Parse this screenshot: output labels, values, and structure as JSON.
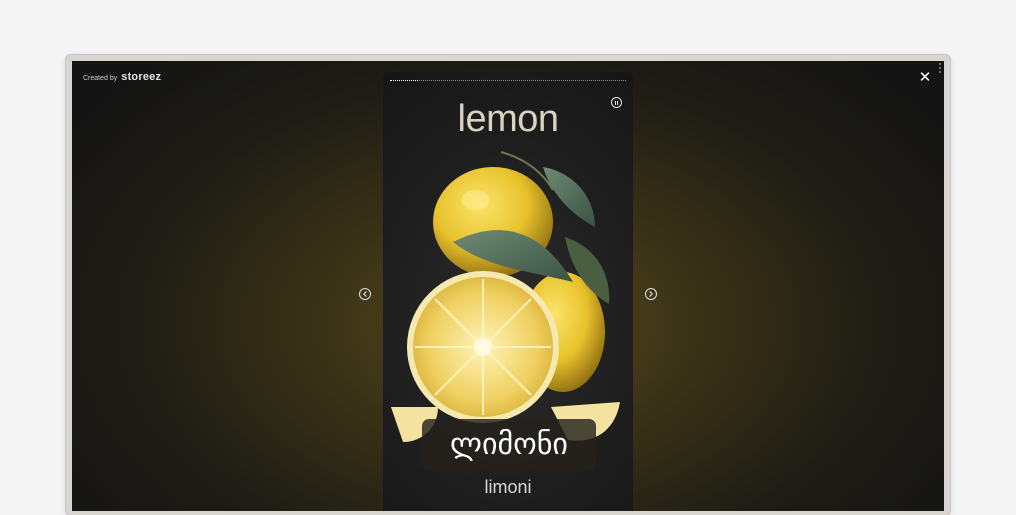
{
  "header": {
    "credit_prefix": "Created by",
    "brand": "storeez"
  },
  "controls": {
    "close_glyph": "✕",
    "prev_icon": "chevron-left-icon",
    "next_icon": "chevron-right-icon",
    "pause_icon": "pause-icon"
  },
  "story": {
    "progress_fraction": 0.12,
    "title": "lemon",
    "caption": "ლიმონი",
    "subcaption": "limoni",
    "image": "lemon-illustration"
  },
  "colors": {
    "background": "#f5f5f6",
    "lemon": "#f1d23a",
    "leaf": "#4f6b5c"
  }
}
